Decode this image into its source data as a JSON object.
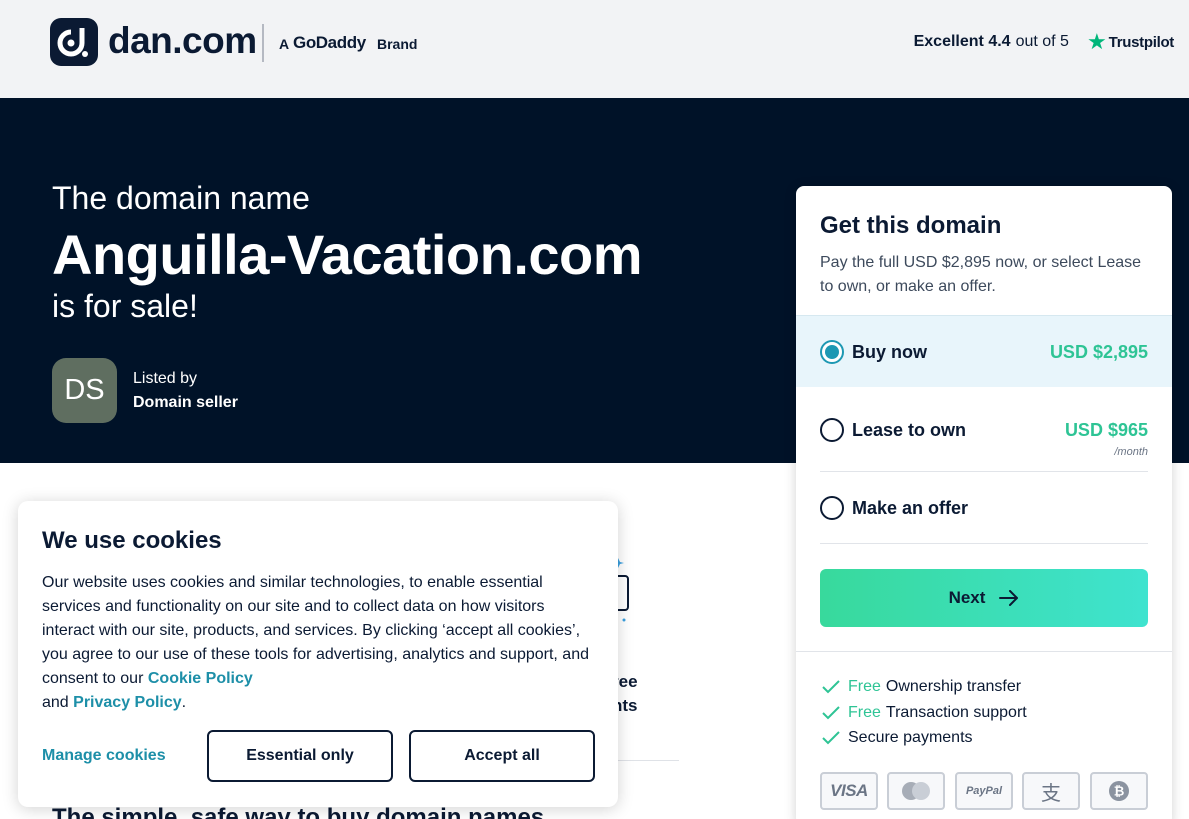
{
  "header": {
    "logo_text": "dan.com",
    "brand_prefix": "A",
    "brand_name": "GoDaddy",
    "brand_suffix": "Brand",
    "rating_label": "Excellent 4.4",
    "rating_rest": "out of 5",
    "trustpilot": "Trustpilot"
  },
  "hero": {
    "line1": "The domain name",
    "domain": "Anguilla-Vacation.com",
    "line3": "is for sale!",
    "avatar_initials": "DS",
    "listed_by": "Listed by",
    "seller": "Domain seller"
  },
  "background": {
    "text1": "ree",
    "text2": "nts",
    "heading": "The simple, safe way to buy domain names"
  },
  "card": {
    "title": "Get this domain",
    "subtitle": "Pay the full USD $2,895 now, or select Lease to own, or make an offer.",
    "options": [
      {
        "label": "Buy now",
        "price": "USD $2,895",
        "selected": true
      },
      {
        "label": "Lease to own",
        "price": "USD $965",
        "per": "/month",
        "selected": false
      },
      {
        "label": "Make an offer",
        "selected": false
      }
    ],
    "next": "Next",
    "features": [
      {
        "free": "Free",
        "text": "Ownership transfer"
      },
      {
        "free": "Free",
        "text": "Transaction support"
      },
      {
        "free": "",
        "text": "Secure payments"
      }
    ],
    "payments": [
      "VISA",
      "mastercard-icon",
      "PayPal",
      "alipay-icon",
      "bitcoin-icon"
    ]
  },
  "cookie": {
    "title": "We use cookies",
    "body_pre": "Our website uses cookies and similar technologies, to enable essential services and functionality on our site and to collect data on how visitors interact with our site, products, and services. By clicking ‘accept all cookies’, you agree to our use of these tools for advertising, analytics and support, and consent to our",
    "cookie_policy": "Cookie Policy",
    "and": "and",
    "privacy_policy": "Privacy Policy",
    "period": ".",
    "manage": "Manage cookies",
    "essential": "Essential only",
    "accept": "Accept all"
  },
  "colors": {
    "navy": "#001228",
    "accent_green": "#2ec495",
    "link_teal": "#1d8fa8",
    "selected_bg": "#e8f5fb"
  }
}
